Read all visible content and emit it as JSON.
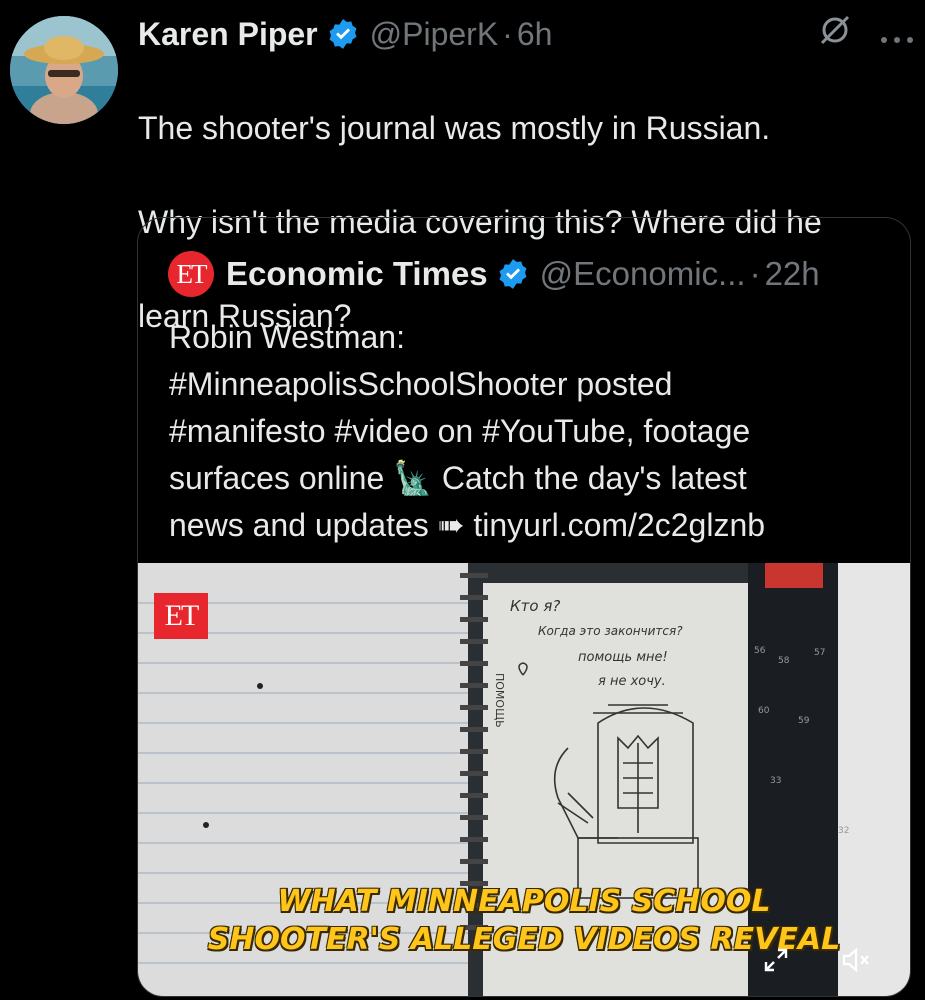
{
  "author": {
    "name": "Karen Piper",
    "handle": "@PiperK",
    "separator": "·",
    "time": "6h"
  },
  "tweet": {
    "lines": [
      "The shooter's journal was mostly in Russian.",
      "Why isn't the media covering this? Where did he",
      "learn Russian?"
    ]
  },
  "quoted": {
    "logo_text": "ET",
    "name": "Economic Times",
    "handle": "@Economic...",
    "separator": "·",
    "time": "22h",
    "lines": [
      "Robin Westman:",
      "#MinneapolisSchoolShooter posted",
      "#manifesto #video on #YouTube, footage",
      "surfaces online 🗽 Catch the day's latest",
      "news and updates ➠ tinyurl.com/2c2glznb"
    ],
    "media": {
      "watermark": "ET",
      "caption_line1": "WHAT MINNEAPOLIS SCHOOL",
      "caption_line2": "SHOOTER'S ALLEGED VIDEOS REVEAL",
      "journal_text": [
        "Кто я?",
        "Когда это закончится?",
        "помощь мне!",
        "я не хочу."
      ],
      "side_text": "ПОМОЩЬ"
    }
  },
  "icons": {
    "verified": "verified-badge-icon",
    "grok": "grok-icon",
    "more": "more-icon",
    "expand": "expand-icon",
    "mute": "volume-muted-icon"
  },
  "colors": {
    "background": "#000000",
    "text": "#e7e9ea",
    "secondary": "#71767b",
    "verified": "#1d9bf0",
    "et_red": "#e8262d",
    "caption": "#ffc51a"
  }
}
